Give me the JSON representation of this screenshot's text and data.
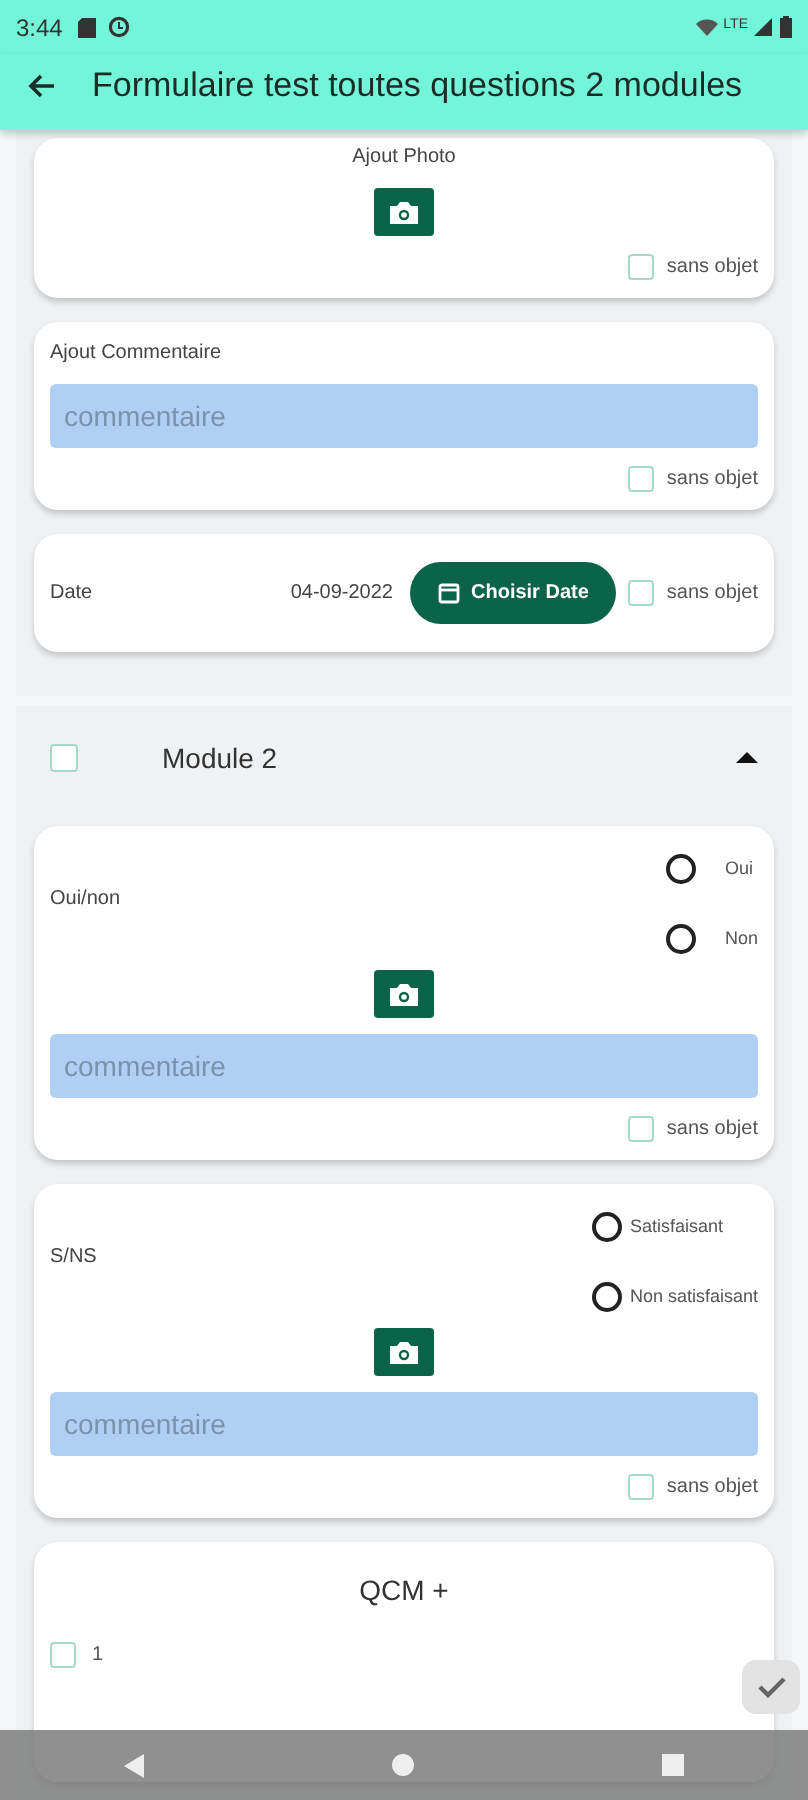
{
  "status_bar": {
    "time": "3:44",
    "network": "LTE"
  },
  "app_bar": {
    "title": "Formulaire test toutes questions 2 modules"
  },
  "modules": [
    {
      "cards": [
        {
          "kind": "photo",
          "label": "Ajout Photo",
          "na_label": "sans objet",
          "na_checked": false
        },
        {
          "kind": "comment",
          "label": "Ajout Commentaire",
          "placeholder": "commentaire",
          "na_label": "sans objet",
          "na_checked": false
        },
        {
          "kind": "date",
          "label": "Date",
          "value": "04-09-2022",
          "button": "Choisir Date",
          "na_label": "sans objet",
          "na_checked": false
        }
      ]
    },
    {
      "title": "Module 2",
      "checked": false,
      "expanded": true,
      "cards": [
        {
          "kind": "radio",
          "label": "Oui/non",
          "options": [
            {
              "label": "Oui",
              "selected": false
            },
            {
              "label": "Non",
              "selected": false
            }
          ],
          "placeholder": "commentaire",
          "na_label": "sans objet",
          "na_checked": false
        },
        {
          "kind": "radio",
          "label": "S/NS",
          "options": [
            {
              "label": "Satisfaisant",
              "selected": false
            },
            {
              "label": "Non satisfaisant",
              "selected": false
            }
          ],
          "placeholder": "commentaire",
          "na_label": "sans objet",
          "na_checked": false
        },
        {
          "kind": "qcm",
          "title": "QCM +",
          "options": [
            {
              "label": "1",
              "checked": false
            }
          ]
        }
      ]
    }
  ]
}
